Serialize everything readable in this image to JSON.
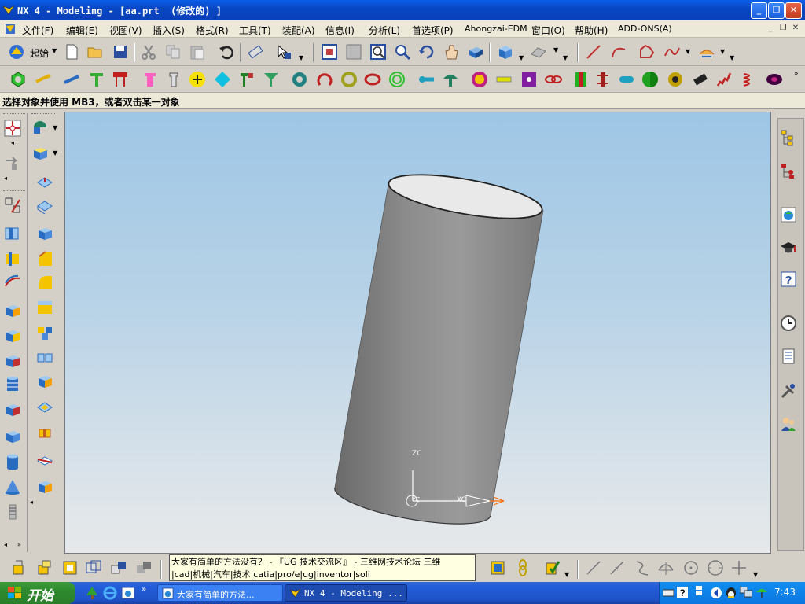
{
  "window": {
    "title": "NX 4 - Modeling - [aa.prt  (修改的) ]"
  },
  "menu": {
    "items": [
      "文件(F)",
      "编辑(E)",
      "视图(V)",
      "插入(S)",
      "格式(R)",
      "工具(T)",
      "装配(A)",
      "信息(I)",
      "分析(L)",
      "首选项(P)",
      "Ahongzai-EDM",
      "窗口(O)",
      "帮助(H)",
      "ADD-ONS(A)"
    ]
  },
  "toolbar": {
    "start_label": "起始"
  },
  "status": {
    "prompt": "选择对象并使用 MB3，或者双击某一对象"
  },
  "viewport": {
    "axis_labels": {
      "zc": "ZC",
      "yc": "YC",
      "xc": "XC"
    },
    "colors": {
      "bg_top": "#9ec6e5",
      "bg_bottom": "#e6e8ea",
      "cylinder": "#8a8a8a"
    }
  },
  "tooltip": {
    "line1": "大家有简单的方法没有？ - 『UG 技术交流区』 - 三维网技术论坛 三维",
    "line2": "|cad|机械|汽车|技术|catia|pro/e|ug|inventor|soli"
  },
  "taskbar": {
    "start_label": "开始",
    "tasks": [
      "大家有简单的方法...",
      "NX 4 - Modeling ..."
    ],
    "clock": "7:43"
  }
}
